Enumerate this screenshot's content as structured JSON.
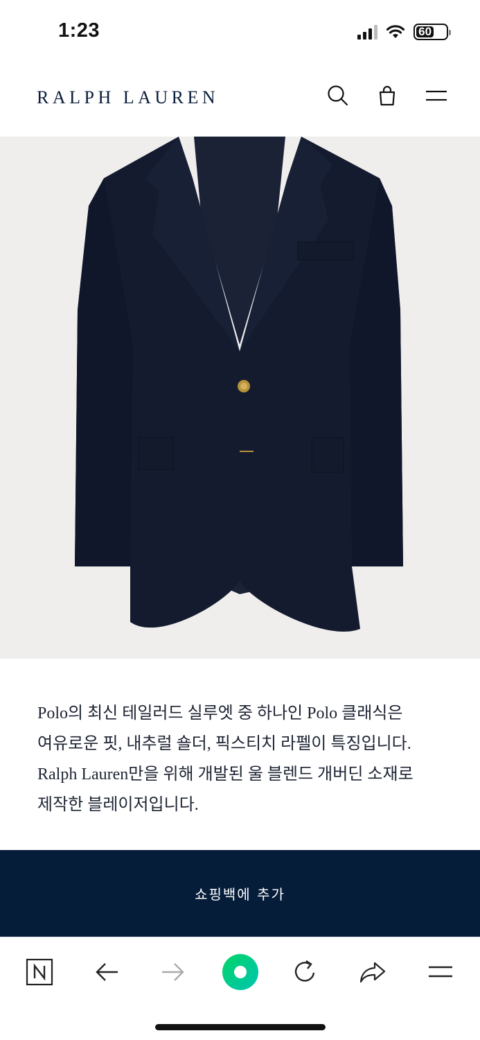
{
  "status_bar": {
    "time": "1:23",
    "battery": "60"
  },
  "header": {
    "brand": "RALPH LAUREN",
    "icons": [
      "search-icon",
      "shopping-bag-icon",
      "menu-icon"
    ]
  },
  "product": {
    "image_alt": "navy blazer",
    "description_lines": [
      "Polo의 최신 테일러드 실루엣 중 하나인 Polo 클래식은",
      "여유로운 핏, 내추럴 숄더, 픽스티치 라펠이 특징입니다.",
      "Ralph Lauren만을 위해 개발된 울 블렌드 개버딘 소재로",
      "제작한 블레이저입니다."
    ]
  },
  "cta": {
    "add_to_bag": "쇼핑백에 추가"
  },
  "browser_toolbar": {
    "items": [
      "naver-n-icon",
      "back-arrow-icon",
      "forward-arrow-icon",
      "naver-green-dot-icon",
      "reload-icon",
      "share-icon",
      "menu-icon"
    ]
  },
  "colors": {
    "navy": "#061d3a",
    "brand_navy": "#0b1d3a",
    "image_bg": "#efeeed",
    "naver_green": "#03c75a"
  }
}
